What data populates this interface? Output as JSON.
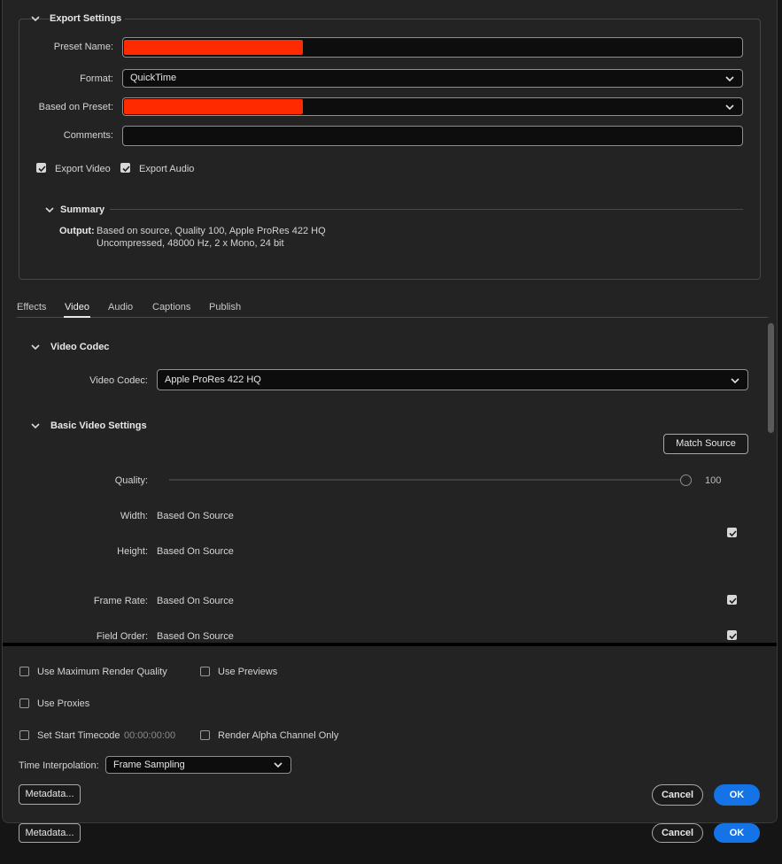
{
  "export_settings": {
    "title": "Export Settings",
    "preset_name_label": "Preset Name:",
    "format_label": "Format:",
    "format_value": "QuickTime",
    "based_on_preset_label": "Based on Preset:",
    "comments_label": "Comments:",
    "comments_value": "",
    "redaction_color": "#ff2a00",
    "export_video_label": "Export Video",
    "export_video_checked": true,
    "export_audio_label": "Export Audio",
    "export_audio_checked": true
  },
  "summary": {
    "title": "Summary",
    "output_label": "Output:",
    "output_line1": "Based on source, Quality 100, Apple ProRes 422 HQ",
    "output_line2": "Uncompressed, 48000 Hz, 2 x Mono, 24 bit"
  },
  "tabs": [
    {
      "label": "Effects",
      "active": false
    },
    {
      "label": "Video",
      "active": true
    },
    {
      "label": "Audio",
      "active": false
    },
    {
      "label": "Captions",
      "active": false
    },
    {
      "label": "Publish",
      "active": false
    }
  ],
  "video_codec": {
    "title": "Video Codec",
    "codec_label": "Video Codec:",
    "codec_value": "Apple ProRes 422 HQ"
  },
  "basic_video": {
    "title": "Basic Video Settings",
    "match_source_label": "Match Source",
    "quality_label": "Quality:",
    "quality_value": "100",
    "quality_fraction": 1.0,
    "width_label": "Width:",
    "width_value": "Based On Source",
    "height_label": "Height:",
    "height_value": "Based On Source",
    "size_linked": true,
    "frame_rate_label": "Frame Rate:",
    "frame_rate_value": "Based On Source",
    "frame_rate_checked": true,
    "field_order_label": "Field Order:",
    "field_order_value": "Based On Source",
    "field_order_checked": true
  },
  "bottom": {
    "max_render_label": "Use Maximum Render Quality",
    "max_render_checked": false,
    "use_previews_label": "Use Previews",
    "use_previews_checked": false,
    "use_proxies_label": "Use Proxies",
    "use_proxies_checked": false,
    "start_tc_label": "Set Start Timecode",
    "start_tc_checked": false,
    "start_tc_value": "00:00:00:00",
    "alpha_label": "Render Alpha Channel Only",
    "alpha_checked": false,
    "time_interp_label": "Time Interpolation:",
    "time_interp_value": "Frame Sampling",
    "metadata_label": "Metadata...",
    "cancel_label": "Cancel",
    "ok_label": "OK"
  },
  "accent_color": "#1473e6"
}
